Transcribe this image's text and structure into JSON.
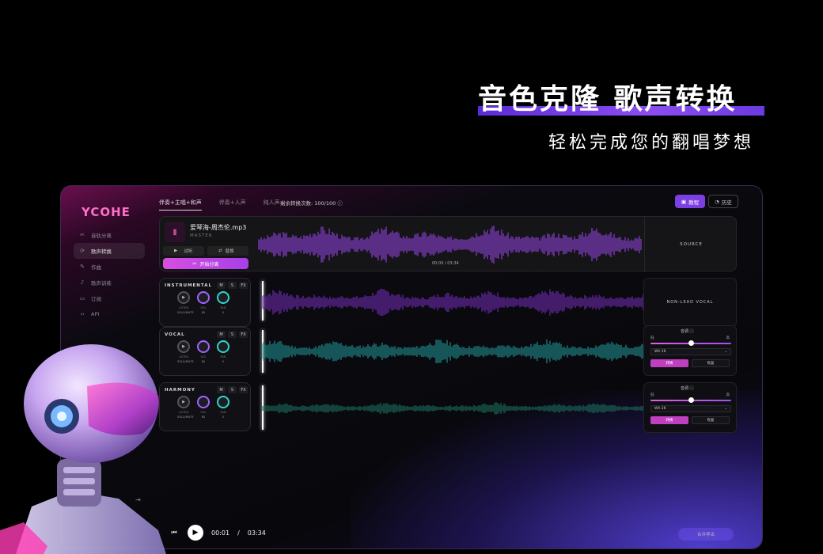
{
  "hero": {
    "title": "音色克隆 歌声转换",
    "subtitle": "轻松完成您的翻唱梦想"
  },
  "app": {
    "logo": "YCOHE",
    "sidebar": {
      "items": [
        {
          "icon": "scissors-icon",
          "label": "音轨分离",
          "active": false
        },
        {
          "icon": "refresh-icon",
          "label": "歌声转换",
          "active": true
        },
        {
          "icon": "pen-icon",
          "label": "作曲",
          "active": false
        },
        {
          "icon": "microphone-icon",
          "label": "歌声训练",
          "active": false
        },
        {
          "icon": "cart-icon",
          "label": "订阅",
          "active": false
        },
        {
          "icon": "code-icon",
          "label": "API",
          "active": false
        }
      ]
    },
    "tabs": [
      {
        "label": "伴奏+主唱+和声",
        "active": true
      },
      {
        "label": "伴奏+人声",
        "active": false
      },
      {
        "label": "纯人声",
        "active": false
      }
    ],
    "remaining_conversions": "剩余转换次数: 100/100",
    "tutorial_label": "教程",
    "history_label": "历史",
    "master": {
      "file_name": "爱琴海-周杰伦.mp3",
      "label": "MASTER",
      "listen_label": "试听",
      "replace_label": "替换",
      "separate_label": "开始分离",
      "time": "00:00 / 03:34",
      "source_label": "SOURCE"
    },
    "tracks": [
      {
        "name": "INSTRUMENTAL",
        "m": "M",
        "s": "S",
        "fx": "FX",
        "knob_labels": [
          "LISTEN",
          "VOL",
          "PAN"
        ],
        "knob_values": [
          "SOLO/MUTE",
          "80",
          "0"
        ],
        "right_label": "NON-LEAD VOCAL"
      },
      {
        "name": "VOCAL",
        "m": "M",
        "s": "S",
        "fx": "FX",
        "knob_labels": [
          "LISTEN",
          "VOL",
          "PAN"
        ],
        "knob_values": [
          "SOLO/MUTE",
          "80",
          "0"
        ],
        "tone_label": "音调",
        "low_label": "低",
        "high_label": "高",
        "model": "WA 26",
        "convert_label": "转换",
        "restore_label": "恢复"
      },
      {
        "name": "HARMONY",
        "m": "M",
        "s": "S",
        "fx": "FX",
        "knob_labels": [
          "LISTEN",
          "VOL",
          "PAN"
        ],
        "knob_values": [
          "SOLO/MUTE",
          "80",
          "0"
        ],
        "tone_label": "音调",
        "low_label": "低",
        "high_label": "高",
        "model": "WA 26",
        "convert_label": "转换",
        "restore_label": "恢复"
      }
    ],
    "player": {
      "current_time": "00:01",
      "separator": "/",
      "total_time": "03:34",
      "export_label": "合并导出"
    }
  },
  "colors": {
    "accent_purple": "#7b3fe4",
    "accent_pink": "#d84fe0",
    "wave_purple": "#8a3fd0",
    "wave_cyan": "#1f8a8a",
    "wave_teal": "#1a6a5a",
    "logo_pink": "#ff6ec7"
  },
  "tone_levels": {
    "vocal": 0.5,
    "harmony": 0.5
  }
}
